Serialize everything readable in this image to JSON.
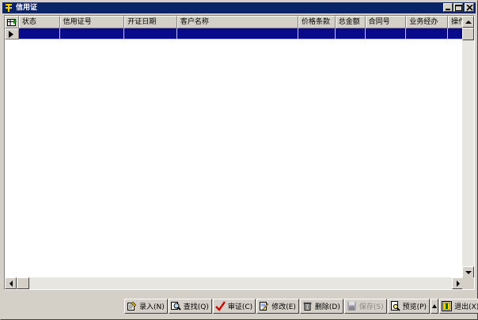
{
  "window": {
    "title": "信用证"
  },
  "grid": {
    "columns": [
      {
        "label": "状态",
        "w": 52
      },
      {
        "label": "信用证号",
        "w": 82
      },
      {
        "label": "开证日期",
        "w": 67
      },
      {
        "label": "客户名称",
        "w": 154
      },
      {
        "label": "价格条款",
        "w": 47
      },
      {
        "label": "总金额",
        "w": 38
      },
      {
        "label": "合同号",
        "w": 52
      },
      {
        "label": "业务经办",
        "w": 53
      },
      {
        "label": "操作",
        "w": 20
      }
    ],
    "selected_row_index": 0
  },
  "toolbar": {
    "buttons": [
      {
        "name": "enter-button",
        "label": "录入(N)",
        "icon": "edit-doc-icon",
        "enabled": true
      },
      {
        "name": "find-button",
        "label": "查找(Q)",
        "icon": "magnifier-icon",
        "enabled": true
      },
      {
        "name": "approve-button",
        "label": "审证(C)",
        "icon": "checkmark-icon",
        "enabled": true
      },
      {
        "name": "modify-button",
        "label": "修改(E)",
        "icon": "pencil-doc-icon",
        "enabled": true
      },
      {
        "name": "delete-button",
        "label": "删除(D)",
        "icon": "trash-icon",
        "enabled": true
      },
      {
        "name": "save-button",
        "label": "保存(S)",
        "icon": "floppy-icon",
        "enabled": false
      },
      {
        "name": "preview-button",
        "label": "预览(P)",
        "icon": "preview-icon",
        "enabled": true
      },
      {
        "name": "exit-button",
        "label": "退出(X)",
        "icon": "exit-icon",
        "enabled": true
      }
    ]
  },
  "colors": {
    "titlebar": "#0a246a",
    "selection": "#0a0a8c",
    "face": "#d4d0c8"
  }
}
